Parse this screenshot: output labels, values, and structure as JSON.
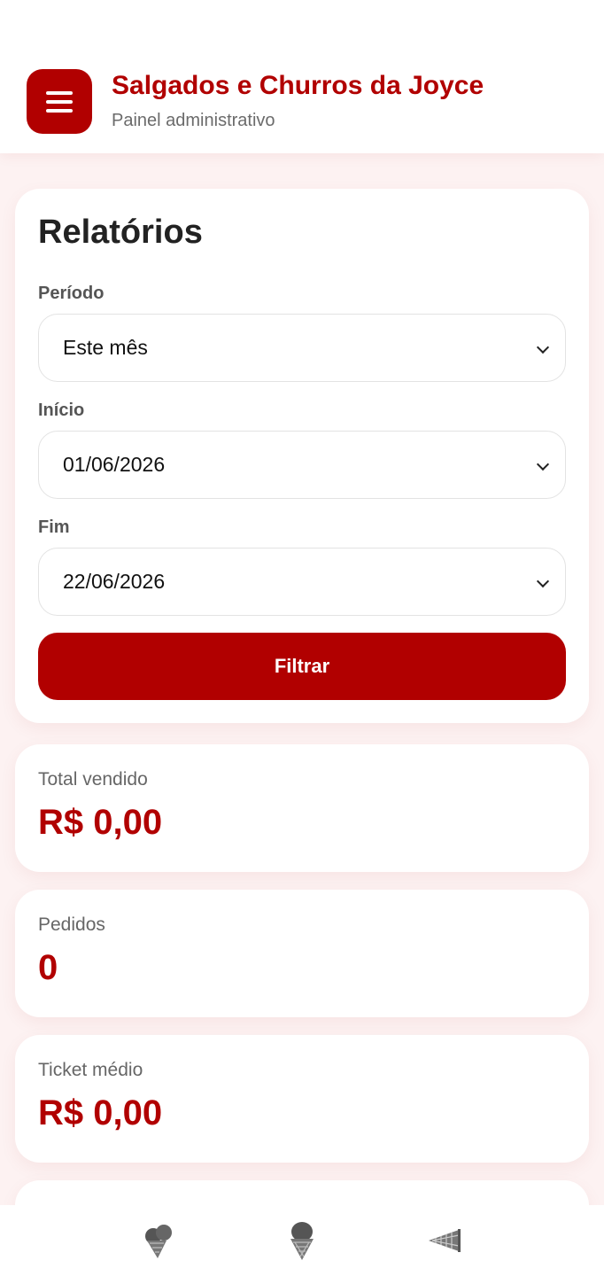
{
  "header": {
    "title": "Salgados e Churros da Joyce",
    "subtitle": "Painel administrativo",
    "menu_icon": "hamburger-menu-icon"
  },
  "report": {
    "title": "Relatórios",
    "period_label": "Período",
    "period_value": "Este mês",
    "start_label": "Início",
    "start_value": "01/06/2026",
    "end_label": "Fim",
    "end_value": "22/06/2026",
    "filter_button": "Filtrar"
  },
  "stats": {
    "total_label": "Total vendido",
    "total_value": "R$ 0,00",
    "orders_label": "Pedidos",
    "orders_value": "0",
    "ticket_label": "Ticket médio",
    "ticket_value": "R$ 0,00"
  },
  "bottom_nav": {
    "items": [
      {
        "icon": "ice-cream-double-icon"
      },
      {
        "icon": "ice-cream-cone-icon"
      },
      {
        "icon": "cone-icon"
      }
    ]
  },
  "colors": {
    "brand": "#b10000",
    "background": "#fdf2f2",
    "muted_text": "#666666"
  }
}
